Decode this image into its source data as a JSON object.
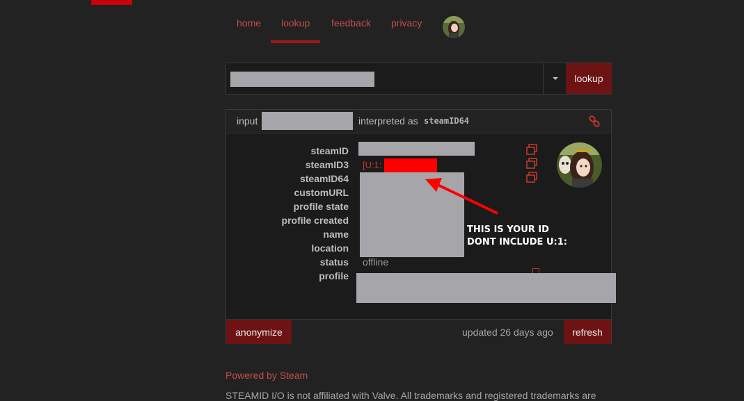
{
  "nav": {
    "items": [
      {
        "label": "home"
      },
      {
        "label": "lookup"
      },
      {
        "label": "feedback"
      },
      {
        "label": "privacy"
      }
    ],
    "active": "lookup"
  },
  "search": {
    "button_label": "lookup"
  },
  "panel": {
    "input_label": "input",
    "interpreted_label": "interpreted as",
    "interpreted_type": "steamID64",
    "labels": [
      "steamID",
      "steamID3",
      "steamID64",
      "customURL",
      "profile state",
      "profile created",
      "name",
      "location",
      "status",
      "profile"
    ],
    "steamid3_prefix": "[U:1:",
    "status_value": "offline",
    "annotation_line1": "THIS IS YOUR ID",
    "annotation_line2": "DONT INCLUDE U:1:"
  },
  "footer": {
    "anonymize_label": "anonymize",
    "updated_text": "updated 26 days ago",
    "refresh_label": "refresh"
  },
  "page_footer": {
    "powered_by": "Powered by Steam",
    "disclaimer": "STEAMID I/O is not affiliated with Valve. All trademarks and registered trademarks are"
  },
  "colors": {
    "accent_red": "#c64b4b",
    "button_red": "#6e1313",
    "redaction_gray": "#a6a5aa",
    "annotation_red": "#ff0000"
  }
}
